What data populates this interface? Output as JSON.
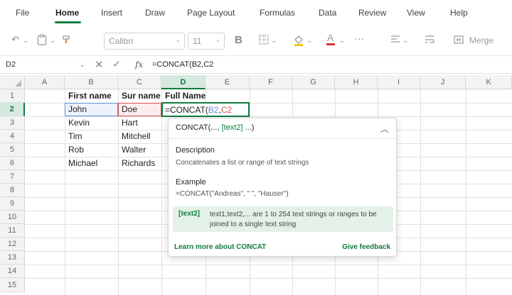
{
  "ribbon": {
    "tabs": [
      {
        "label": "File"
      },
      {
        "label": "Home"
      },
      {
        "label": "Insert"
      },
      {
        "label": "Draw"
      },
      {
        "label": "Page Layout"
      },
      {
        "label": "Formulas"
      },
      {
        "label": "Data"
      },
      {
        "label": "Review"
      },
      {
        "label": "View"
      },
      {
        "label": "Help"
      }
    ],
    "active_tab": "Home"
  },
  "toolbar": {
    "font_name": "Calibri",
    "font_size": "11",
    "bold_label": "B",
    "more_label": "···",
    "merge_label": "Merge"
  },
  "formula_bar": {
    "name_box": "D2",
    "fx_label": "fx",
    "formula": "=CONCAT(B2,C2"
  },
  "grid": {
    "columns": [
      "A",
      "B",
      "C",
      "D",
      "E",
      "F",
      "G",
      "H",
      "I",
      "J",
      "K"
    ],
    "selected_column": "D",
    "rows": [
      "1",
      "2",
      "3",
      "4",
      "5",
      "6",
      "7",
      "8",
      "9",
      "10",
      "11",
      "12",
      "13",
      "14",
      "15"
    ],
    "selected_row": "2",
    "headers": {
      "b1": "First name",
      "c1": "Sur name",
      "d1": "Full Name"
    },
    "first_names": [
      "John",
      "Kevin",
      "Tim",
      "Rob",
      "Michael"
    ],
    "sur_names": [
      "Doe",
      "Hart",
      "Mitchell",
      "Walter",
      "Richards"
    ],
    "active_cell": {
      "prefix": "=CONCAT(",
      "ref1": "B2",
      "sep": ",",
      "ref2": "C2"
    }
  },
  "tooltip": {
    "signature_prefix": "CONCAT(...,",
    "signature_arg": "[text2]",
    "signature_suffix": "...)",
    "description_heading": "Description",
    "description_text": "Concatenates a list or range of text strings",
    "example_heading": "Example",
    "example_text": "=CONCAT(\"Andreas\", \" \", \"Hauser\")",
    "arg_name": "[text2]",
    "arg_description": "text1,text2,... are 1 to 254 text strings or ranges to be joined to a single text string",
    "learn_more": "Learn more about CONCAT",
    "feedback": "Give feedback"
  },
  "colors": {
    "accent": "#107c41",
    "ref_b": "#5b8ed8",
    "ref_c": "#d9534f",
    "arg_highlight": "#e3f1e8"
  }
}
